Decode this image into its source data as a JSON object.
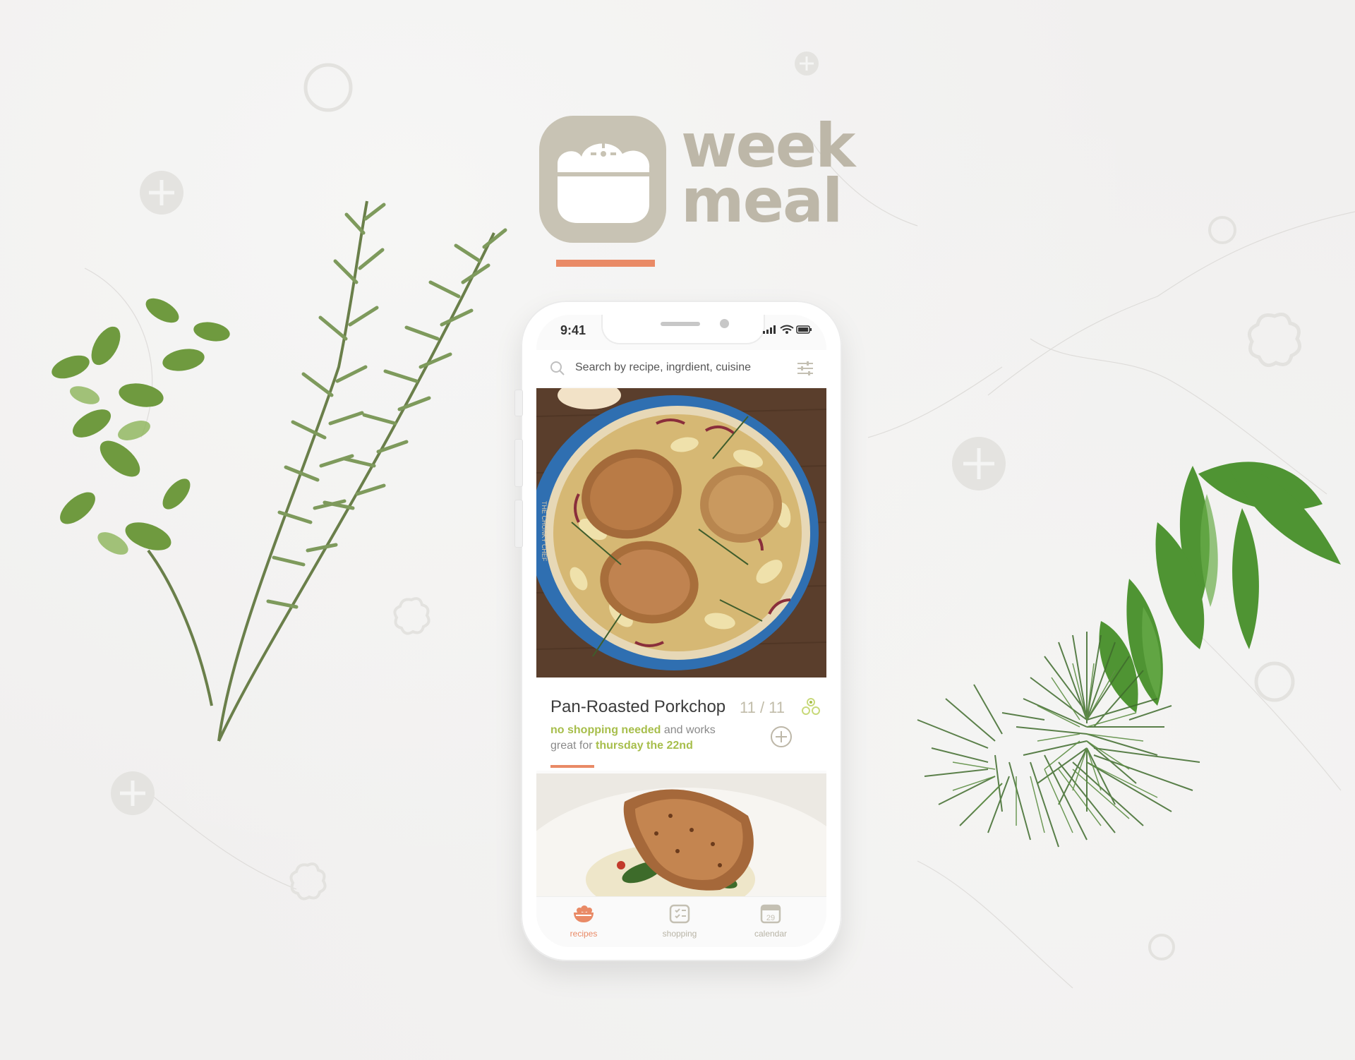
{
  "brand": {
    "name_line1": "week",
    "name_line2": "meal"
  },
  "status_bar": {
    "time": "9:41"
  },
  "search": {
    "placeholder": "Search by recipe, ingrdient, cuisine"
  },
  "recipe_card": {
    "title": "Pan-Roasted Porkchop",
    "count": "11 / 11",
    "desc_highlight_1": "no shopping needed",
    "desc_text_1": " and works great for ",
    "desc_highlight_2": "thursday the 22nd",
    "photo_watermark": "THE CHUNKY CHEF"
  },
  "tabs": [
    {
      "label": "recipes",
      "active": true,
      "icon": "bowl-icon"
    },
    {
      "label": "shopping",
      "active": false,
      "icon": "checklist-icon"
    },
    {
      "label": "calendar",
      "active": false,
      "icon": "calendar-icon",
      "badge": "29"
    }
  ],
  "colors": {
    "accent": "#e98a66",
    "highlight_green": "#a7be4b",
    "logo_gray": "#bdb7a8",
    "background": "#f1f0ef"
  }
}
